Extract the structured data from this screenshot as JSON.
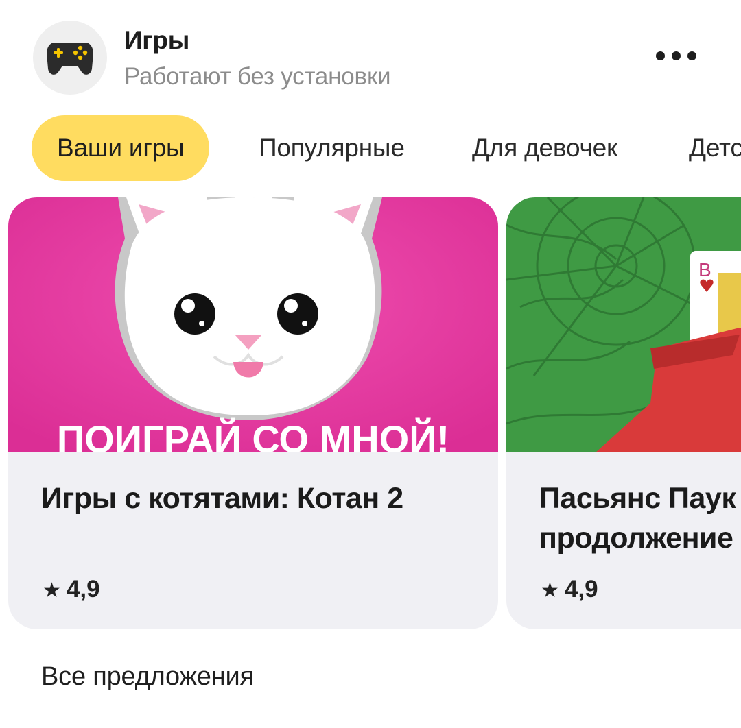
{
  "header": {
    "title": "Игры",
    "subtitle": "Работают без установки",
    "icon": "gamepad-icon",
    "more_icon": "more-dots-icon"
  },
  "tabs": [
    {
      "label": "Ваши игры",
      "active": true
    },
    {
      "label": "Популярные",
      "active": false
    },
    {
      "label": "Для девочек",
      "active": false
    },
    {
      "label": "Детские",
      "active": false
    }
  ],
  "cards": [
    {
      "title": "Игры с котятами: Котан 2",
      "rating": "4,9",
      "image_caption": "ПОИГРАЙ СО МНОЙ!",
      "image": "kitten-image"
    },
    {
      "title_line1": "Пасьянс Паук",
      "title_line2": "продолжение",
      "rating": "4,9",
      "image": "spider-solitaire-image"
    }
  ],
  "footer": {
    "all_offers": "Все предложения"
  },
  "colors": {
    "accent": "#ffdc60",
    "card_bg": "#f0f0f4",
    "kitten_bg": "#e2359c",
    "solitaire_bg": "#3f9a44"
  }
}
